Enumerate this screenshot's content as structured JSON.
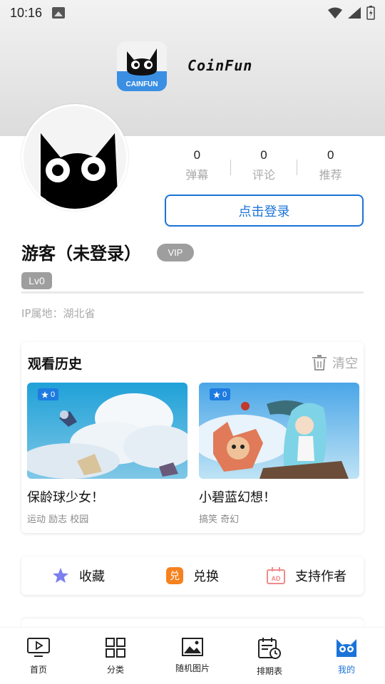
{
  "status_bar": {
    "time": "10:16"
  },
  "app": {
    "name": "CoinFun",
    "logo_text": "CAINFUN"
  },
  "stats": [
    {
      "value": "0",
      "label": "弹幕"
    },
    {
      "value": "0",
      "label": "评论"
    },
    {
      "value": "0",
      "label": "推荐"
    }
  ],
  "login_button": "点击登录",
  "user": {
    "name": "游客（未登录）",
    "vip": "VIP",
    "level": "Lv0",
    "ip": "IP属地：湖北省"
  },
  "history": {
    "title": "观看历史",
    "clear_label": "清空",
    "items": [
      {
        "title": "保龄球少女！",
        "tags": "运动 励志 校园",
        "stars": "0"
      },
      {
        "title": "小碧蓝幻想！",
        "tags": "搞笑 奇幻",
        "stars": "0"
      }
    ]
  },
  "actions": [
    {
      "label": "收藏",
      "icon": "star-icon"
    },
    {
      "label": "兑换",
      "icon": "exchange-icon"
    },
    {
      "label": "支持作者",
      "icon": "ad-icon"
    }
  ],
  "bottom_nav": [
    {
      "label": "首页",
      "icon": "tv-icon"
    },
    {
      "label": "分类",
      "icon": "grid-icon"
    },
    {
      "label": "随机图片",
      "icon": "image-icon"
    },
    {
      "label": "排期表",
      "icon": "calendar-clock-icon"
    },
    {
      "label": "我的",
      "icon": "cat-icon",
      "active": true
    }
  ],
  "colors": {
    "accent": "#1a73d8",
    "badge_gray": "#9e9e9e",
    "exchange_orange": "#f5821f",
    "star_purple": "#7b7fef",
    "ad_pink": "#f08a8a"
  }
}
